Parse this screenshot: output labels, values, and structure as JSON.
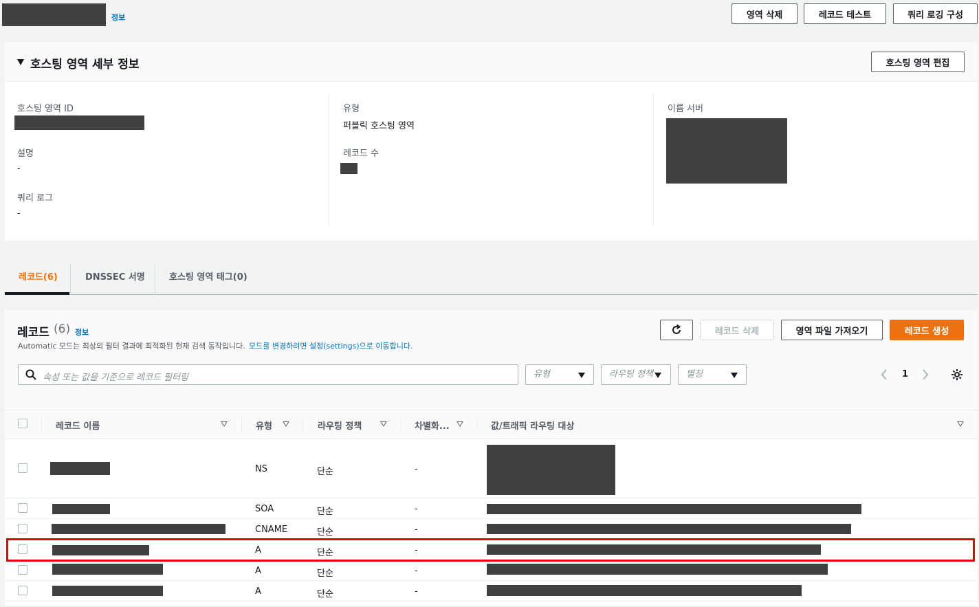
{
  "header": {
    "info_link": "정보",
    "buttons": {
      "delete_zone": "영역 삭제",
      "test_record": "레코드 테스트",
      "query_logging": "쿼리 로깅 구성"
    }
  },
  "details": {
    "title": "호스팅 영역 세부 정보",
    "edit_button": "호스팅 영역 편집",
    "zone_id_label": "호스팅 영역 ID",
    "description_label": "설명",
    "description_value": "-",
    "query_log_label": "쿼리 로그",
    "query_log_value": "-",
    "type_label": "유형",
    "type_value": "퍼블릭 호스팅 영역",
    "record_count_label": "레코드 수",
    "name_servers_label": "이름 서버"
  },
  "tabs": [
    {
      "label": "레코드(6)",
      "active": true
    },
    {
      "label": "DNSSEC 서명",
      "active": false
    },
    {
      "label": "호스팅 영역 태그(0)",
      "active": false
    }
  ],
  "records": {
    "title": "레코드",
    "count": "(6)",
    "info_link": "정보",
    "description": "Automatic 모드는 최상의 필터 결과에 최적화된 현재 검색 동작입니다.",
    "description_link": "모드를 변경하려면 설정(settings)으로 이동합니다.",
    "buttons": {
      "delete": "레코드 삭제",
      "import": "영역 파일 가져오기",
      "create": "레코드 생성"
    },
    "search_placeholder": "속성 또는 값을 기준으로 레코드 필터링",
    "filters": {
      "type": "유형",
      "routing": "라우팅 정책",
      "alias": "별칭"
    },
    "page": "1",
    "columns": [
      "레코드 이름",
      "유형",
      "라우팅 정책",
      "차별화...",
      "값/트래픽 라우팅 대상"
    ],
    "rows": [
      {
        "type": "NS",
        "routing": "단순",
        "diff": "-"
      },
      {
        "type": "SOA",
        "routing": "단순",
        "diff": "-"
      },
      {
        "type": "CNAME",
        "routing": "단순",
        "diff": "-"
      },
      {
        "type": "A",
        "routing": "단순",
        "diff": "-",
        "highlighted": true
      },
      {
        "type": "A",
        "routing": "단순",
        "diff": "-"
      },
      {
        "type": "A",
        "routing": "단순",
        "diff": "-"
      }
    ]
  },
  "colors": {
    "accent": "#ec7211",
    "link": "#0073bb",
    "highlight": "#e00000"
  }
}
